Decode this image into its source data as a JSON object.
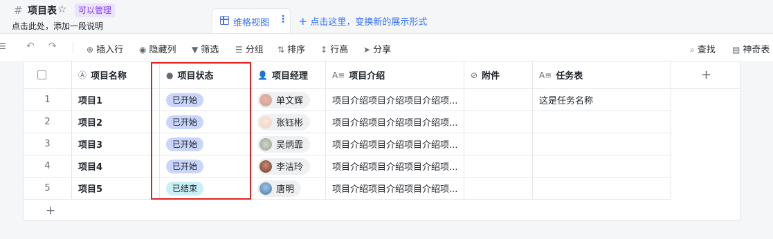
{
  "header": {
    "title": "项目表",
    "permission_badge": "可以管理",
    "description": "点击此处，添加一段说明"
  },
  "views": {
    "active_view": "维格视图",
    "more": "⋮",
    "add_view": "点击这里，变换新的展示形式"
  },
  "toolbar": {
    "insert_row": "插入行",
    "hide_columns": "隐藏列",
    "filter": "筛选",
    "group": "分组",
    "sort": "排序",
    "row_height": "行高",
    "share": "分享",
    "find": "查找",
    "magic_form": "神奇表"
  },
  "table": {
    "columns": {
      "name": "项目名称",
      "status": "项目状态",
      "manager": "项目经理",
      "intro": "项目介绍",
      "attachment": "附件",
      "task": "任务表"
    },
    "rows": [
      {
        "index": "1",
        "name": "项目1",
        "status": "已开始",
        "manager": "单文辉",
        "intro": "项目介绍项目介绍项目介绍项...",
        "task": "这是任务名称"
      },
      {
        "index": "2",
        "name": "项目2",
        "status": "已开始",
        "manager": "张钰彬",
        "intro": "项目介绍项目介绍项目介绍项...",
        "task": ""
      },
      {
        "index": "3",
        "name": "项目3",
        "status": "已开始",
        "manager": "吴炳霏",
        "intro": "项目介绍项目介绍项目介绍项...",
        "task": ""
      },
      {
        "index": "4",
        "name": "项目4",
        "status": "已开始",
        "manager": "李洁玲",
        "intro": "项目介绍项目介绍项目介绍项...",
        "task": ""
      },
      {
        "index": "5",
        "name": "项目5",
        "status": "已结束",
        "manager": "唐明",
        "intro": "项目介绍项目介绍项目介绍项...",
        "task": ""
      }
    ]
  },
  "colors": {
    "status_started": "#c9d5fb",
    "status_ended": "#c9f0f8",
    "highlight_border": "#e02020",
    "accent": "#3370ff"
  },
  "icons": [
    "hash-icon",
    "star-icon",
    "grid-view-icon",
    "more-icon",
    "plus-icon",
    "undo-icon",
    "redo-icon",
    "insert-icon",
    "eye-icon",
    "filter-icon",
    "group-icon",
    "sort-icon",
    "row-height-icon",
    "share-icon",
    "search-icon",
    "form-icon"
  ]
}
